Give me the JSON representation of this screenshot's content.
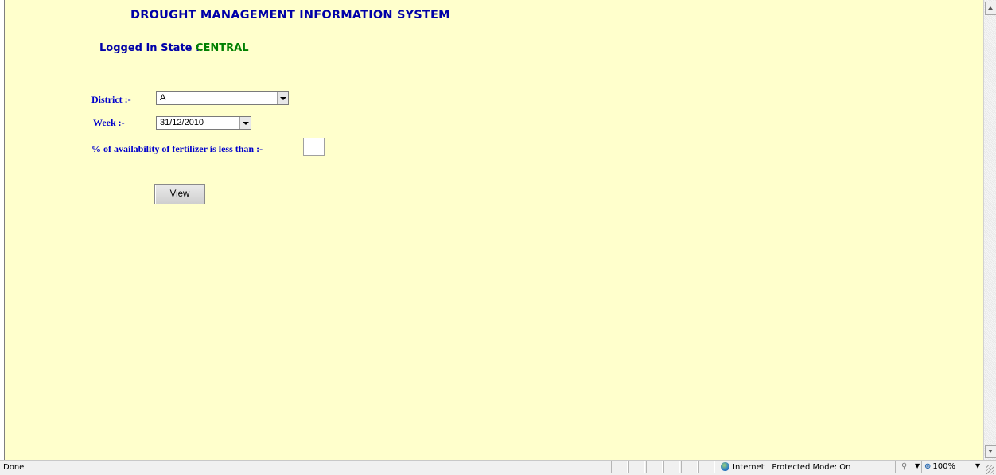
{
  "page": {
    "title": "DROUGHT MANAGEMENT INFORMATION SYSTEM",
    "state_label": "Logged In State :",
    "state_value": "CENTRAL"
  },
  "form": {
    "district_label": "District :-",
    "district_value": "A",
    "week_label": "Week :-",
    "week_value": "31/12/2010",
    "fertilizer_label": "% of availability of fertilizer is less than :-",
    "fertilizer_value": "",
    "view_button": "View"
  },
  "statusbar": {
    "status": "Done",
    "zone": "Internet | Protected Mode: On",
    "zoom": "100%"
  },
  "colors": {
    "page_bg": "#ffffcc",
    "title": "#0000a8",
    "state_value": "#008000",
    "label": "#0000cc"
  }
}
